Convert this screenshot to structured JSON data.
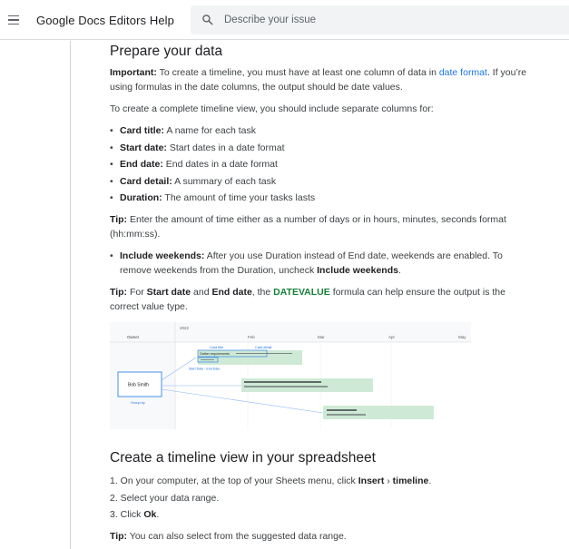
{
  "header": {
    "app_title": "Google Docs Editors Help",
    "search_placeholder": "Describe your issue"
  },
  "section1": {
    "heading": "Prepare your data",
    "important_label": "Important:",
    "important_text_a": " To create a timeline, you must have at least one column of data in ",
    "important_link": "date format",
    "important_text_b": ". If you’re using formulas in the date columns, the output should be date values.",
    "intro": "To create a complete timeline view, you should include separate columns for:",
    "columns": [
      {
        "label": "Card title:",
        "text": " A name for each task"
      },
      {
        "label": "Start date:",
        "text": " Start dates in a date format"
      },
      {
        "label": "End date:",
        "text": " End dates in a date format"
      },
      {
        "label": "Card detail:",
        "text": " A summary of each task"
      },
      {
        "label": "Duration:",
        "text": " The amount of time your tasks lasts"
      }
    ],
    "tip1_label": "Tip:",
    "tip1_text": " Enter the amount of time either as a number of days or in hours, minutes, seconds format (hh:mm:ss).",
    "weekends_label": "Include weekends:",
    "weekends_text": " After you use Duration instead of End date, weekends are enabled. To remove weekends from the Duration, uncheck ",
    "weekends_bold": "Include weekends",
    "weekends_end": ".",
    "tip2_label": "Tip:",
    "tip2_a": " For ",
    "tip2_b1": "Start date",
    "tip2_and": " and ",
    "tip2_b2": "End date",
    "tip2_c": ", the ",
    "tip2_fn": "DATEVALUE",
    "tip2_d": " formula can help ensure the output is the correct value type."
  },
  "diagram": {
    "year": "2022",
    "owner_header": "Owner",
    "months": [
      "Feb",
      "Mar",
      "Apr",
      "May"
    ],
    "card_title_label": "Card title",
    "card_detail_label": "Card detail",
    "start_end_label": "Start Date - End Date",
    "owner_name": "Bob Smith",
    "group_label": "Group by",
    "card_text": "Gather requirements",
    "accent": "#1a73e8",
    "bar_color": "#ceead6"
  },
  "section2": {
    "heading": "Create a timeline view in your spreadsheet",
    "step1_a": "1. On your computer, at the top of your Sheets menu, click ",
    "step1_insert": "Insert",
    "step1_arrow": " › ",
    "step1_timeline": "timeline",
    "step1_end": ".",
    "step2": "2. Select your data range.",
    "step3_a": "3. Click ",
    "step3_ok": "Ok",
    "step3_end": ".",
    "tip_label": "Tip:",
    "tip_text": " You can also select from the suggested data range."
  }
}
